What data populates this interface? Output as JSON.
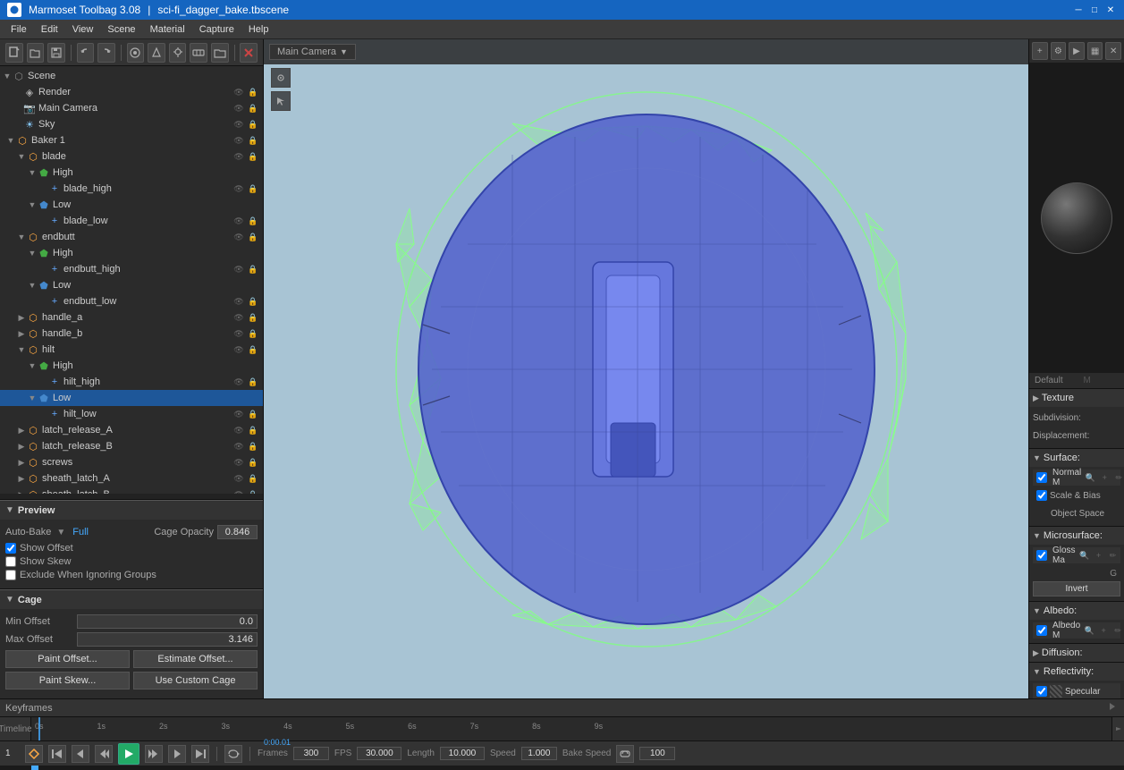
{
  "titlebar": {
    "icon": "marmoset-icon",
    "app_name": "Marmoset Toolbag 3.08",
    "separator": "|",
    "file_name": "sci-fi_dagger_bake.tbscene"
  },
  "menubar": {
    "items": [
      "File",
      "Edit",
      "View",
      "Scene",
      "Material",
      "Capture",
      "Help"
    ]
  },
  "toolbar": {
    "buttons": [
      "new",
      "open",
      "save",
      "undo",
      "redo",
      "scene-objects",
      "materials",
      "lights",
      "cameras",
      "environment",
      "folder",
      "delete"
    ]
  },
  "scene_tree": {
    "items": [
      {
        "id": "scene",
        "label": "Scene",
        "level": 0,
        "type": "scene",
        "expanded": true
      },
      {
        "id": "render",
        "label": "Render",
        "level": 1,
        "type": "render"
      },
      {
        "id": "main-camera",
        "label": "Main Camera",
        "level": 1,
        "type": "camera"
      },
      {
        "id": "sky",
        "label": "Sky",
        "level": 1,
        "type": "sky"
      },
      {
        "id": "baker1",
        "label": "Baker 1",
        "level": 1,
        "type": "baker",
        "expanded": true
      },
      {
        "id": "blade",
        "label": "blade",
        "level": 2,
        "type": "group",
        "expanded": true
      },
      {
        "id": "blade-high",
        "label": "High",
        "level": 3,
        "type": "high",
        "expanded": false
      },
      {
        "id": "blade-high-mesh",
        "label": "blade_high",
        "level": 4,
        "type": "mesh"
      },
      {
        "id": "blade-low",
        "label": "Low",
        "level": 3,
        "type": "low",
        "expanded": false
      },
      {
        "id": "blade-low-mesh",
        "label": "blade_low",
        "level": 4,
        "type": "mesh"
      },
      {
        "id": "endbutt",
        "label": "endbutt",
        "level": 2,
        "type": "group",
        "expanded": true
      },
      {
        "id": "endbutt-high",
        "label": "High",
        "level": 3,
        "type": "high",
        "expanded": false
      },
      {
        "id": "endbutt-high-mesh",
        "label": "endbutt_high",
        "level": 4,
        "type": "mesh"
      },
      {
        "id": "endbutt-low",
        "label": "Low",
        "level": 3,
        "type": "low",
        "expanded": false
      },
      {
        "id": "endbutt-low-mesh",
        "label": "endbutt_low",
        "level": 4,
        "type": "mesh"
      },
      {
        "id": "handle_a",
        "label": "handle_a",
        "level": 2,
        "type": "group"
      },
      {
        "id": "handle_b",
        "label": "handle_b",
        "level": 2,
        "type": "group"
      },
      {
        "id": "hilt",
        "label": "hilt",
        "level": 2,
        "type": "group",
        "expanded": true
      },
      {
        "id": "hilt-high",
        "label": "High",
        "level": 3,
        "type": "high",
        "expanded": false
      },
      {
        "id": "hilt-high-mesh",
        "label": "hilt_high",
        "level": 4,
        "type": "mesh"
      },
      {
        "id": "hilt-low",
        "label": "Low",
        "level": 3,
        "type": "low",
        "selected": true,
        "expanded": false
      },
      {
        "id": "hilt-low-mesh",
        "label": "hilt_low",
        "level": 4,
        "type": "mesh"
      },
      {
        "id": "latch_release_A",
        "label": "latch_release_A",
        "level": 2,
        "type": "group"
      },
      {
        "id": "latch_release_B",
        "label": "latch_release_B",
        "level": 2,
        "type": "group"
      },
      {
        "id": "screws",
        "label": "screws",
        "level": 2,
        "type": "group"
      },
      {
        "id": "sheath_latch_A",
        "label": "sheath_latch_A",
        "level": 2,
        "type": "group"
      },
      {
        "id": "sheath_latch_B",
        "label": "sheath_latch_B",
        "level": 2,
        "type": "group"
      }
    ]
  },
  "preview": {
    "section_label": "Preview",
    "auto_bake_label": "Auto-Bake",
    "auto_bake_value": "Full",
    "show_offset_label": "Show Offset",
    "show_offset_checked": true,
    "show_skew_label": "Show Skew",
    "show_skew_checked": false,
    "exclude_groups_label": "Exclude When Ignoring Groups",
    "exclude_groups_checked": false,
    "cage_opacity_label": "Cage Opacity",
    "cage_opacity_value": "0.846"
  },
  "cage": {
    "section_label": "Cage",
    "min_offset_label": "Min Offset",
    "min_offset_value": "0.0",
    "max_offset_label": "Max Offset",
    "max_offset_value": "3.146",
    "paint_offset_btn": "Paint Offset...",
    "paint_skew_btn": "Paint Skew...",
    "estimate_offset_btn": "Estimate Offset...",
    "use_custom_cage_btn": "Use Custom Cage"
  },
  "viewport": {
    "camera_label": "Main Camera",
    "settings_icon": "settings-icon"
  },
  "timeline": {
    "keyframes_label": "Keyframes",
    "timeline_label": "Timeline",
    "ruler_marks": [
      "0s",
      "1s",
      "2s",
      "3s",
      "4s",
      "5s",
      "6s",
      "7s",
      "8s",
      "9s"
    ],
    "time_display": "0:00.01",
    "frame_number": "1",
    "frames_label": "Frames",
    "frames_value": "300",
    "fps_label": "FPS",
    "fps_value": "30.000",
    "length_label": "Length",
    "length_value": "10.000",
    "speed_label": "Speed",
    "speed_value": "1.000",
    "bake_speed_label": "Bake Speed",
    "bake_link_icon": "link-icon",
    "bake_speed_value": "100"
  },
  "right_panel": {
    "default_label": "Default",
    "m_tab": "M",
    "texture_section": "Texture",
    "subdivision_label": "Subdivision:",
    "displacement_label": "Displacement:",
    "surface_section": "Surface:",
    "normal_map_label": "Normal M",
    "scale_bias_label": "Scale & Bias",
    "object_space_label": "Object Space",
    "microsurface_section": "Microsurface:",
    "gloss_map_label": "Gloss Ma",
    "invert_btn": "Invert",
    "albedo_section": "Albedo:",
    "albedo_map_label": "Albedo M",
    "diffusion_section": "Diffusion:",
    "reflectivity_section": "Reflectivity:",
    "specular_label": "Specular"
  }
}
